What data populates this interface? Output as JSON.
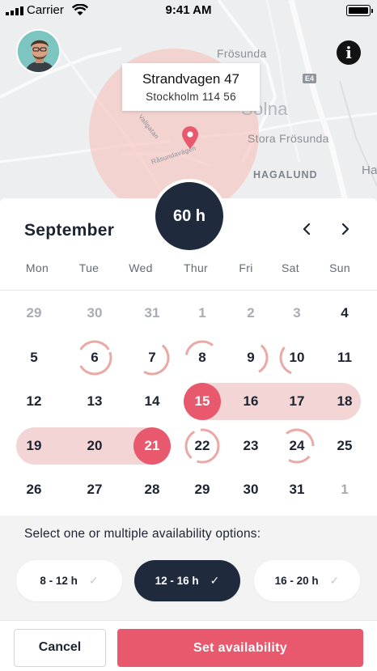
{
  "status_bar": {
    "carrier": "Carrier",
    "time": "9:41 AM"
  },
  "map": {
    "labels": {
      "frosunda": "Frösunda",
      "solna": "Solna",
      "stora_frosunda": "Stora Frösunda",
      "hagalund": "HAGALUND",
      "ha": "Ha",
      "road": "E4",
      "street1": "Råsundavägen",
      "street2": "Vallgatan"
    },
    "accent_circle_color": "#f6c9c6"
  },
  "address": {
    "street": "Strandvagen 47",
    "city": "Stockholm 114 56"
  },
  "calendar": {
    "hours_total": "60 h",
    "month": "September",
    "prev_icon": "‹",
    "next_icon": "›",
    "weekdays": [
      "Mon",
      "Tue",
      "Wed",
      "Thur",
      "Fri",
      "Sat",
      "Sun"
    ],
    "weeks": [
      [
        "29",
        "30",
        "31",
        "1",
        "2",
        "3",
        "4"
      ],
      [
        "5",
        "6",
        "7",
        "8",
        "9",
        "10",
        "11"
      ],
      [
        "12",
        "13",
        "14",
        "15",
        "16",
        "17",
        "18"
      ],
      [
        "19",
        "20",
        "21",
        "22",
        "23",
        "24",
        "25"
      ],
      [
        "26",
        "27",
        "28",
        "29",
        "30",
        "31",
        "1"
      ]
    ],
    "muted_days": [
      "29",
      "30",
      "31",
      "1",
      "2",
      "3",
      "1b"
    ],
    "selected_days": [
      "15",
      "21"
    ],
    "partial_days": [
      "6",
      "7",
      "8",
      "9",
      "10",
      "22",
      "24"
    ],
    "accent": "#e8596d",
    "range_color": "#f2d5d4"
  },
  "availability": {
    "prompt": "Select one or multiple availability options:",
    "options": [
      {
        "label": "8 - 12 h",
        "check": "✓"
      },
      {
        "label": "12 - 16 h",
        "check": "✓"
      },
      {
        "label": "16 - 20 h",
        "check": "✓"
      }
    ],
    "selected_option": "12 - 16 h"
  },
  "footer": {
    "cancel_label": "Cancel",
    "submit_label": "Set availability"
  }
}
